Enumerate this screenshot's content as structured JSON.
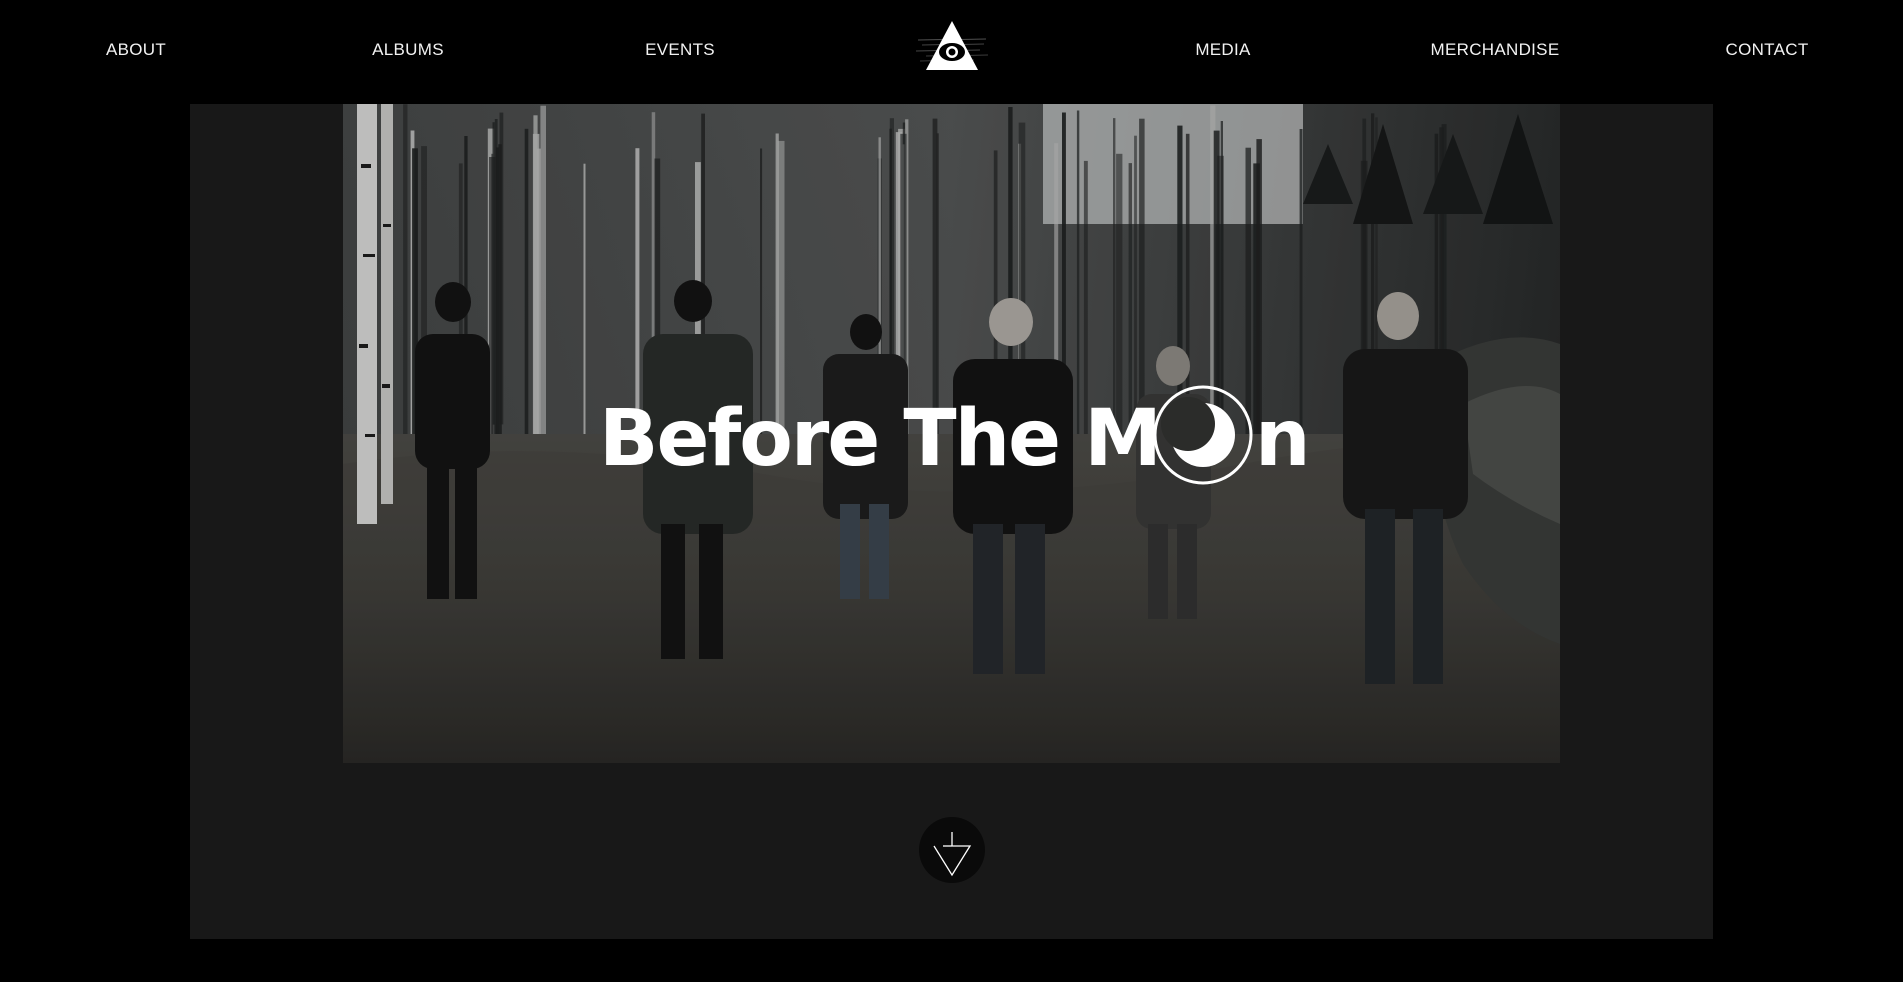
{
  "nav": {
    "items": [
      {
        "label": "ABOUT"
      },
      {
        "label": "ALBUMS"
      },
      {
        "label": "EVENTS"
      },
      {
        "label": "MEDIA"
      },
      {
        "label": "MERCHANDISE"
      },
      {
        "label": "CONTACT"
      }
    ],
    "logo_icon": "eye-triangle-icon"
  },
  "hero": {
    "band_name": "Before The Moon",
    "logo_text_left": "Before The M",
    "logo_text_right": "n",
    "moon_icon": "crescent-moon-icon"
  },
  "scroll": {
    "icon": "arrow-down-icon"
  },
  "colors": {
    "background": "#000000",
    "panel": "#181818",
    "text": "#f2f2f2"
  }
}
